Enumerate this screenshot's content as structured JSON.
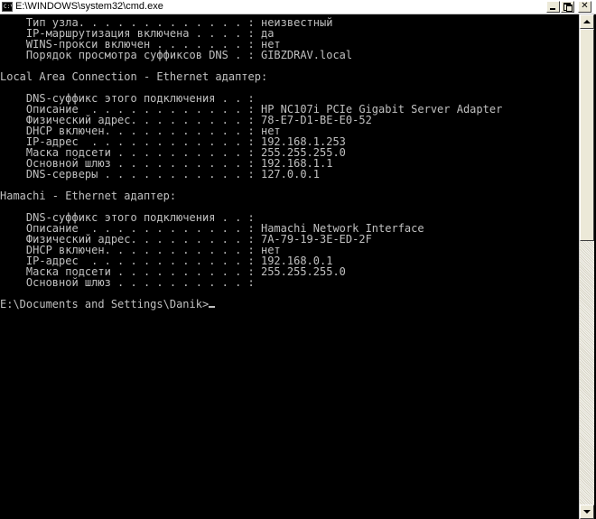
{
  "window": {
    "title": "E:\\WINDOWS\\system32\\cmd.exe",
    "icon_label": "C:\\"
  },
  "console": {
    "lines": [
      "    Тип узла. . . . . . . . . . . . . : неизвестный",
      "    IP-маршрутизация включена . . . . : да",
      "    WINS-прокси включен . . . . . . . : нет",
      "    Порядок просмотра суффиксов DNS . : GIBZDRAV.local",
      "",
      "Local Area Connection - Ethernet адаптер:",
      "",
      "    DNS-суффикс этого подключения . . :",
      "    Описание  . . . . . . . . . . . . : HP NC107i PCIe Gigabit Server Adapter",
      "    Физический адрес. . . . . . . . . : 78-E7-D1-BE-E0-52",
      "    DHCP включен. . . . . . . . . . . : нет",
      "    IP-адрес  . . . . . . . . . . . . : 192.168.1.253",
      "    Маска подсети . . . . . . . . . . : 255.255.255.0",
      "    Основной шлюз . . . . . . . . . . : 192.168.1.1",
      "    DNS-серверы . . . . . . . . . . . : 127.0.0.1",
      "",
      "Hamachi - Ethernet адаптер:",
      "",
      "    DNS-суффикс этого подключения . . :",
      "    Описание  . . . . . . . . . . . . : Hamachi Network Interface",
      "    Физический адрес. . . . . . . . . : 7A-79-19-3E-ED-2F",
      "    DHCP включен. . . . . . . . . . . : нет",
      "    IP-адрес  . . . . . . . . . . . . : 192.168.0.1",
      "    Маска подсети . . . . . . . . . . : 255.255.255.0",
      "    Основной шлюз . . . . . . . . . . :",
      ""
    ],
    "prompt": "E:\\Documents and Settings\\Danik>",
    "text_color": "#c0c0c0",
    "background_color": "#000000"
  },
  "icons": {
    "minimize": "minimize-icon",
    "maximize": "maximize-icon",
    "close": "close-icon",
    "scroll_up": "arrow-up-icon",
    "scroll_down": "arrow-down-icon"
  }
}
